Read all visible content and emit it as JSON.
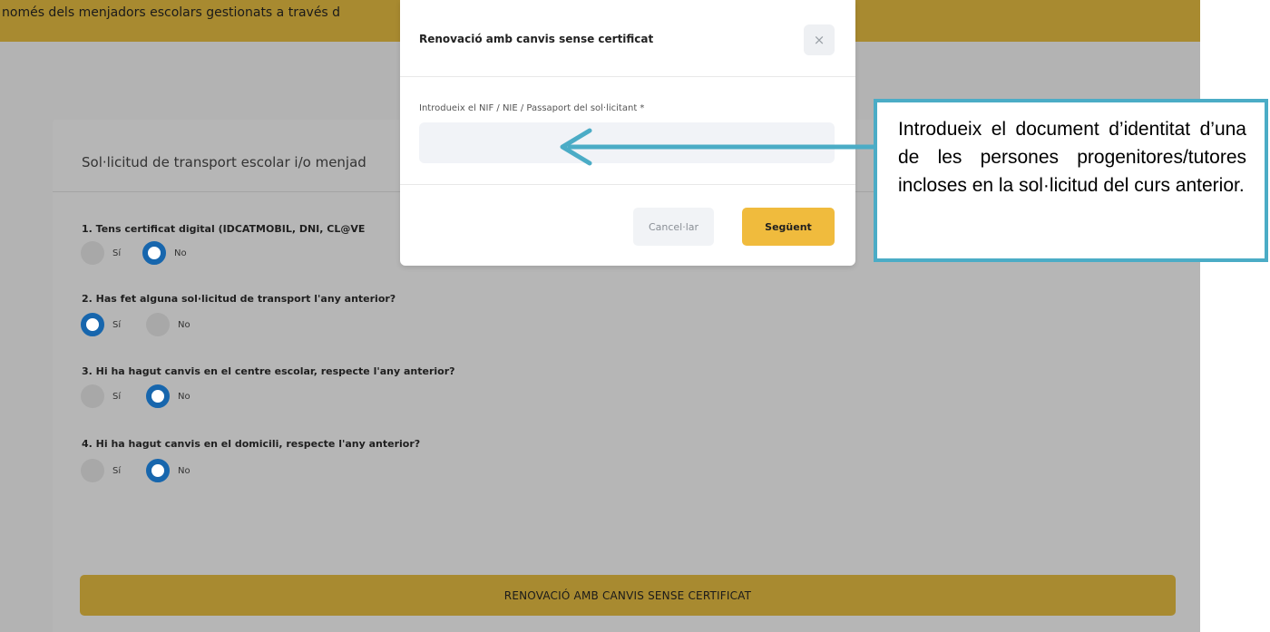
{
  "banner": {
    "text": "només dels menjadors escolars gestionats a través d"
  },
  "form": {
    "title": "Sol·licitud de transport escolar i/o menjad",
    "questions": [
      {
        "label": "1. Tens certificat digital (IDCATMOBIL, DNI, CL@VE",
        "options": [
          "Sí",
          "No"
        ],
        "selected": "No"
      },
      {
        "label": "2. Has fet alguna sol·licitud de transport l'any anterior?",
        "options": [
          "Sí",
          "No"
        ],
        "selected": "Sí"
      },
      {
        "label": "3. Hi ha hagut canvis en el centre escolar, respecte l'any anterior?",
        "options": [
          "Sí",
          "No"
        ],
        "selected": "No"
      },
      {
        "label": "4. Hi ha hagut canvis en el domicili, respecte l'any anterior?",
        "options": [
          "Sí",
          "No"
        ],
        "selected": "No"
      }
    ],
    "submit_label": "RENOVACIÓ AMB CANVIS SENSE CERTIFICAT"
  },
  "modal": {
    "title": "Renovació amb canvis sense certificat",
    "close_glyph": "×",
    "field_label": "Introdueix el NIF / NIE / Passaport del sol·licitant *",
    "field_value": "",
    "cancel_label": "Cancel·lar",
    "next_label": "Següent"
  },
  "callout": {
    "text": "Introdueix el document d’identitat d’una de les persones progenitores/tutores incloses en la sol·licitud del curs anterior."
  },
  "colors": {
    "accent_gold": "#a88a30",
    "radio_blue": "#1766ad",
    "next_button": "#f0bb3d",
    "callout_border": "#4bacc6"
  },
  "icons": {
    "close": "close-icon",
    "annotation_arrow": "arrow-left-icon"
  }
}
